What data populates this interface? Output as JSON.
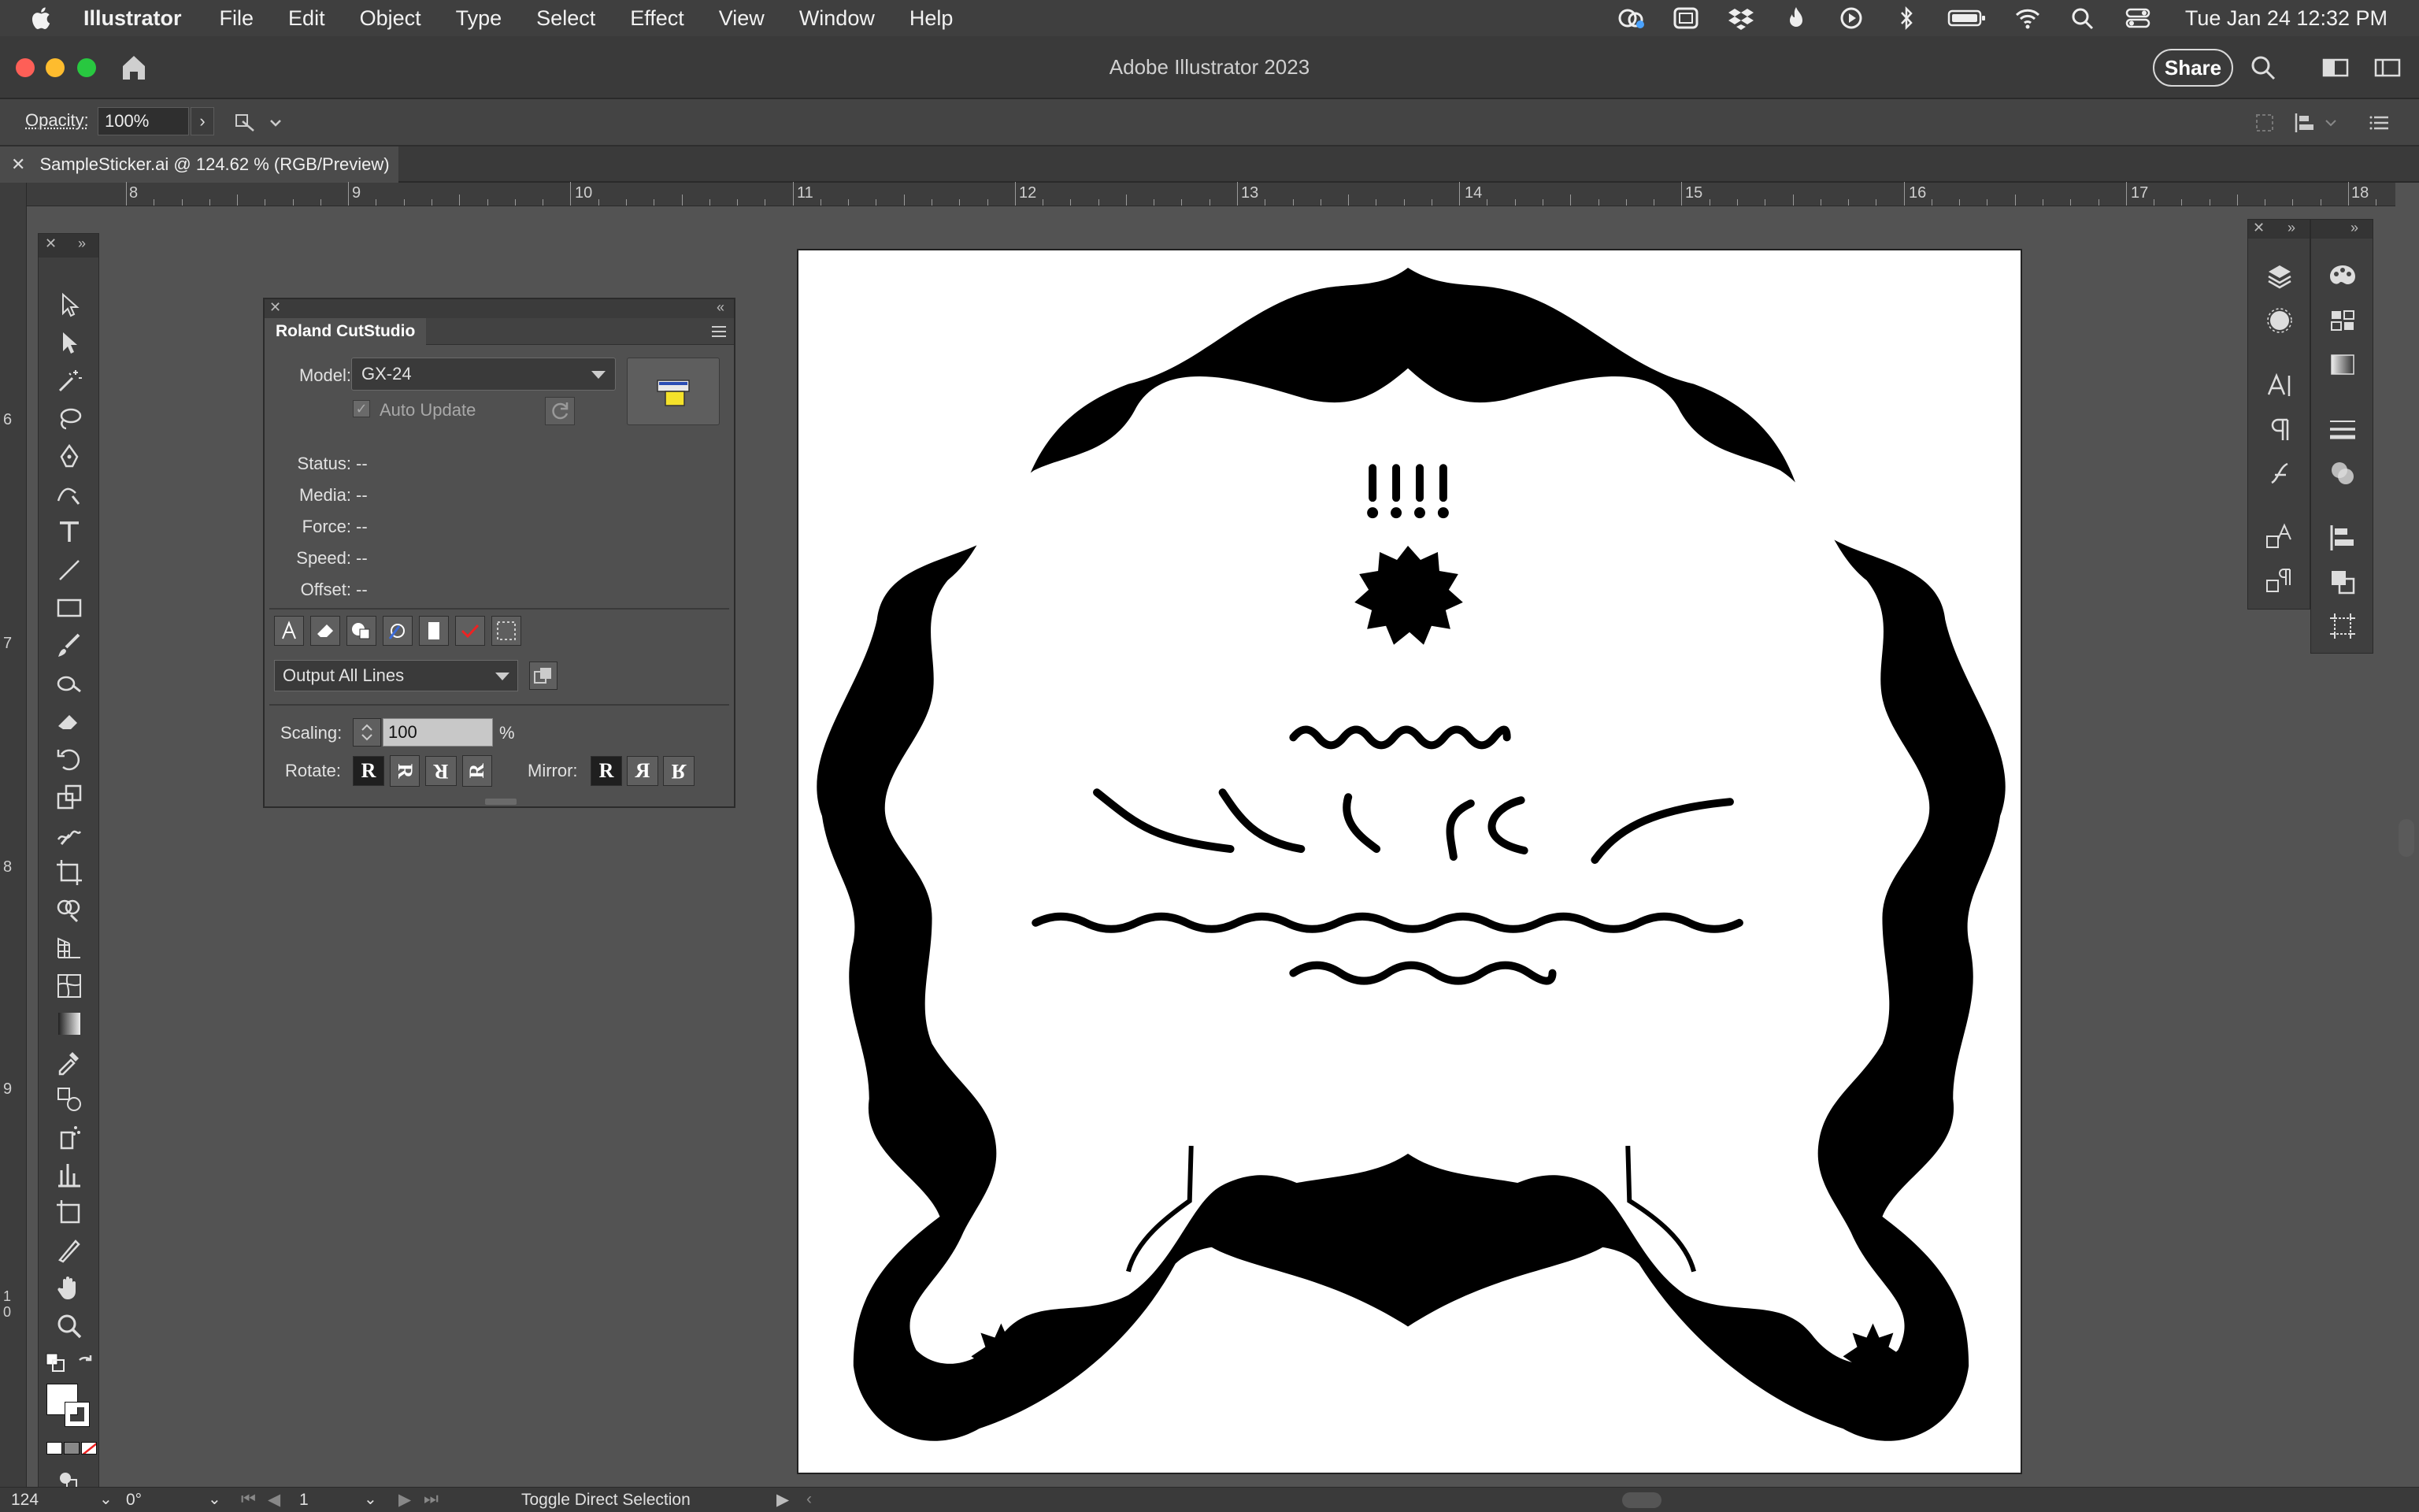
{
  "menubar": {
    "app": "Illustrator",
    "items": [
      "File",
      "Edit",
      "Object",
      "Type",
      "Select",
      "Effect",
      "View",
      "Window",
      "Help"
    ],
    "clock": "Tue Jan 24  12:32 PM"
  },
  "window": {
    "title": "Adobe Illustrator 2023",
    "share_label": "Share"
  },
  "controlbar": {
    "opacity_label": "Opacity:",
    "opacity_value": "100%"
  },
  "document": {
    "tab_label": "SampleSticker.ai @ 124.62 % (RGB/Preview)"
  },
  "ruler": {
    "top_labels": [
      "8",
      "9",
      "10",
      "11",
      "12",
      "13",
      "14",
      "15",
      "16",
      "17",
      "18"
    ],
    "left_labels": [
      "6",
      "7",
      "8",
      "9",
      "10"
    ]
  },
  "roland_panel": {
    "tab_label": "Roland CutStudio",
    "model_label": "Model:",
    "model_value": "GX-24",
    "auto_update_label": "Auto Update",
    "status_label": "Status:",
    "status_value": "--",
    "media_label": "Media:",
    "media_value": "--",
    "force_label": "Force:",
    "force_value": "--",
    "speed_label": "Speed:",
    "speed_value": "--",
    "offset_label": "Offset:",
    "offset_value": "--",
    "output_value": "Output All Lines",
    "scaling_label": "Scaling:",
    "scaling_value": "100",
    "scaling_unit": "%",
    "rotate_label": "Rotate:",
    "mirror_label": "Mirror:",
    "rotate_glyphs": [
      "R",
      "R",
      "R",
      "R"
    ],
    "mirror_glyphs": [
      "R",
      "R",
      "R"
    ]
  },
  "statusbar": {
    "zoom_value": "124",
    "rotation_value": "0°",
    "page_value": "1",
    "tool_status": "Toggle Direct Selection"
  },
  "colors": {
    "fill": "#ffffff",
    "stroke": "#000000",
    "artwork": "#000000",
    "ui_bg": "#535353"
  }
}
